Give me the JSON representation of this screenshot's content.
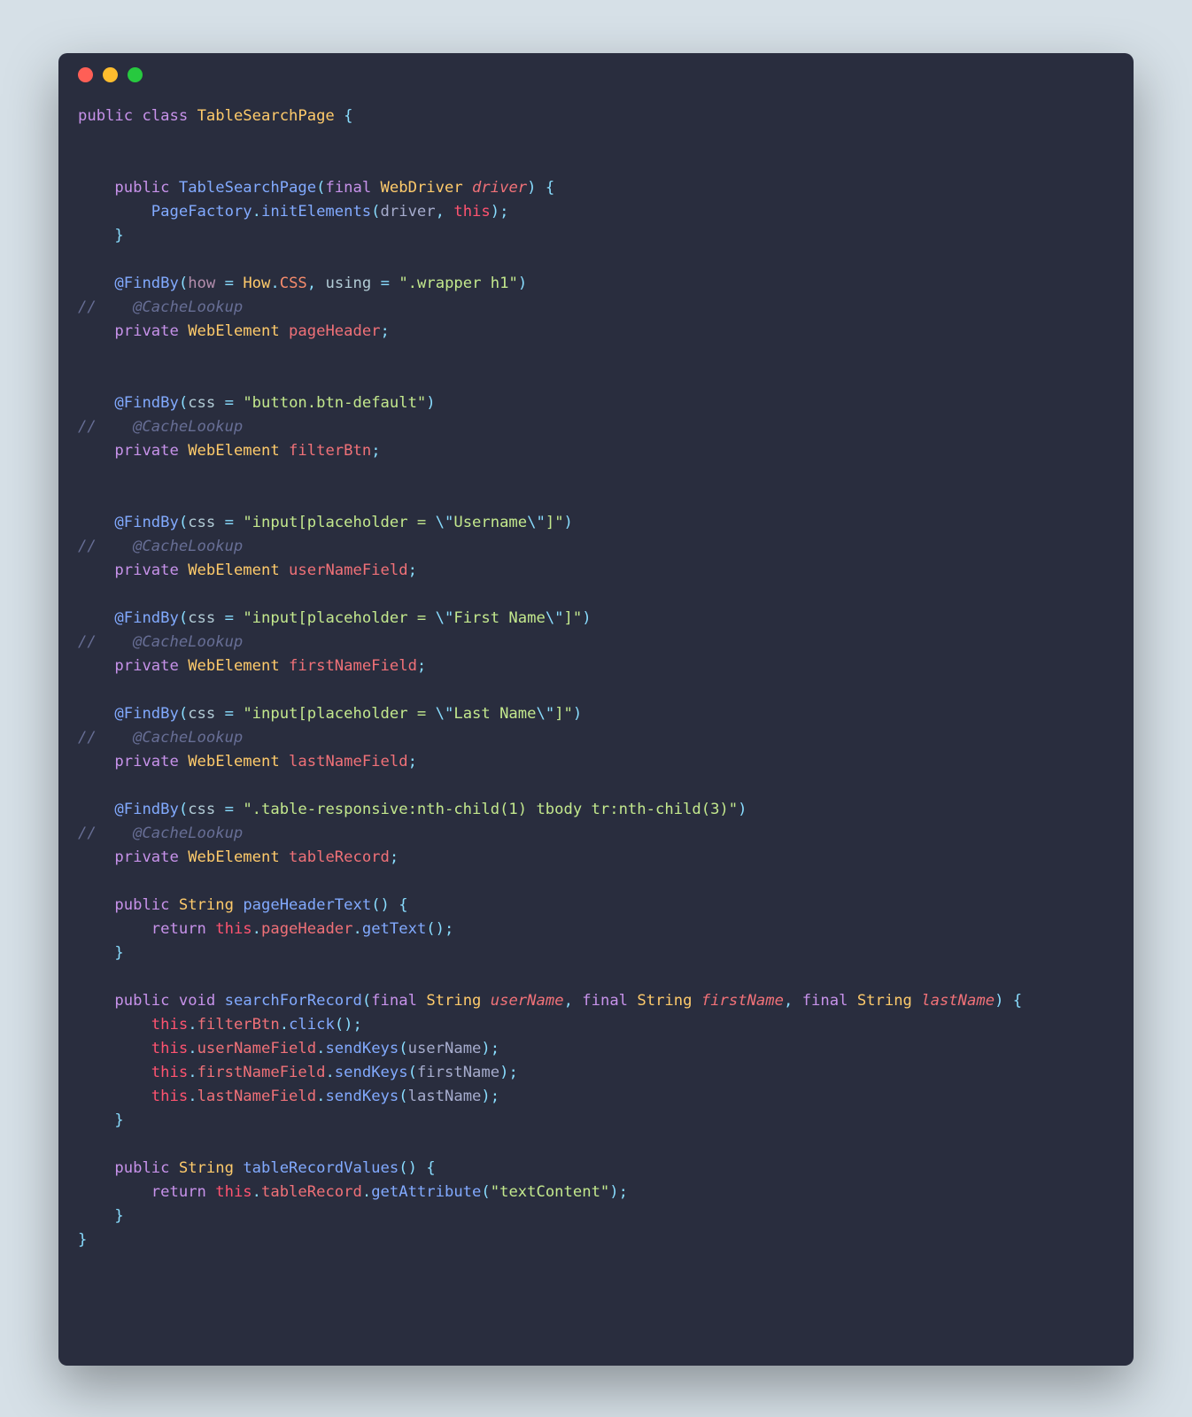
{
  "window": {
    "traffic_lights": [
      "close",
      "minimize",
      "zoom"
    ]
  },
  "code": {
    "language": "java",
    "tokens": [
      [
        [
          "kw",
          "public"
        ],
        [
          "plain",
          " "
        ],
        [
          "kw",
          "class"
        ],
        [
          "plain",
          " "
        ],
        [
          "type",
          "TableSearchPage"
        ],
        [
          "plain",
          " "
        ],
        [
          "op",
          "{"
        ]
      ],
      [],
      [],
      [
        [
          "plain",
          "    "
        ],
        [
          "kw",
          "public"
        ],
        [
          "plain",
          " "
        ],
        [
          "name",
          "TableSearchPage"
        ],
        [
          "op",
          "("
        ],
        [
          "kw",
          "final"
        ],
        [
          "plain",
          " "
        ],
        [
          "type",
          "WebDriver"
        ],
        [
          "plain",
          " "
        ],
        [
          "param",
          "driver"
        ],
        [
          "op",
          ")"
        ],
        [
          "plain",
          " "
        ],
        [
          "op",
          "{"
        ]
      ],
      [
        [
          "plain",
          "        "
        ],
        [
          "name",
          "PageFactory"
        ],
        [
          "op",
          "."
        ],
        [
          "name",
          "initElements"
        ],
        [
          "op",
          "("
        ],
        [
          "plain",
          "driver"
        ],
        [
          "op",
          ","
        ],
        [
          "plain",
          " "
        ],
        [
          "this",
          "this"
        ],
        [
          "op",
          ")"
        ],
        [
          "op",
          ";"
        ]
      ],
      [
        [
          "plain",
          "    "
        ],
        [
          "op",
          "}"
        ]
      ],
      [],
      [
        [
          "plain",
          "    "
        ],
        [
          "ann",
          "@FindBy"
        ],
        [
          "op",
          "("
        ],
        [
          "kwhow",
          "how"
        ],
        [
          "plain",
          " "
        ],
        [
          "op",
          "="
        ],
        [
          "plain",
          " "
        ],
        [
          "type",
          "How"
        ],
        [
          "op",
          "."
        ],
        [
          "const",
          "CSS"
        ],
        [
          "op",
          ","
        ],
        [
          "plain",
          " "
        ],
        [
          "css",
          "using"
        ],
        [
          "plain",
          " "
        ],
        [
          "op",
          "="
        ],
        [
          "plain",
          " "
        ],
        [
          "str",
          "\".wrapper h1\""
        ],
        [
          "op",
          ")"
        ]
      ],
      [
        [
          "cmt",
          "//    @CacheLookup"
        ]
      ],
      [
        [
          "plain",
          "    "
        ],
        [
          "kw",
          "private"
        ],
        [
          "plain",
          " "
        ],
        [
          "type",
          "WebElement"
        ],
        [
          "plain",
          " "
        ],
        [
          "field",
          "pageHeader"
        ],
        [
          "op",
          ";"
        ]
      ],
      [],
      [],
      [
        [
          "plain",
          "    "
        ],
        [
          "ann",
          "@FindBy"
        ],
        [
          "op",
          "("
        ],
        [
          "css",
          "css"
        ],
        [
          "plain",
          " "
        ],
        [
          "op",
          "="
        ],
        [
          "plain",
          " "
        ],
        [
          "str",
          "\"button.btn-default\""
        ],
        [
          "op",
          ")"
        ]
      ],
      [
        [
          "cmt",
          "//    @CacheLookup"
        ]
      ],
      [
        [
          "plain",
          "    "
        ],
        [
          "kw",
          "private"
        ],
        [
          "plain",
          " "
        ],
        [
          "type",
          "WebElement"
        ],
        [
          "plain",
          " "
        ],
        [
          "field",
          "filterBtn"
        ],
        [
          "op",
          ";"
        ]
      ],
      [],
      [],
      [
        [
          "plain",
          "    "
        ],
        [
          "ann",
          "@FindBy"
        ],
        [
          "op",
          "("
        ],
        [
          "css",
          "css"
        ],
        [
          "plain",
          " "
        ],
        [
          "op",
          "="
        ],
        [
          "plain",
          " "
        ],
        [
          "str",
          "\"input[placeholder = "
        ],
        [
          "esc",
          "\\\""
        ],
        [
          "str",
          "Username"
        ],
        [
          "esc",
          "\\\""
        ],
        [
          "str",
          "]\""
        ],
        [
          "op",
          ")"
        ]
      ],
      [
        [
          "cmt",
          "//    @CacheLookup"
        ]
      ],
      [
        [
          "plain",
          "    "
        ],
        [
          "kw",
          "private"
        ],
        [
          "plain",
          " "
        ],
        [
          "type",
          "WebElement"
        ],
        [
          "plain",
          " "
        ],
        [
          "field",
          "userNameField"
        ],
        [
          "op",
          ";"
        ]
      ],
      [],
      [
        [
          "plain",
          "    "
        ],
        [
          "ann",
          "@FindBy"
        ],
        [
          "op",
          "("
        ],
        [
          "css",
          "css"
        ],
        [
          "plain",
          " "
        ],
        [
          "op",
          "="
        ],
        [
          "plain",
          " "
        ],
        [
          "str",
          "\"input[placeholder = "
        ],
        [
          "esc",
          "\\\""
        ],
        [
          "str",
          "First Name"
        ],
        [
          "esc",
          "\\\""
        ],
        [
          "str",
          "]\""
        ],
        [
          "op",
          ")"
        ]
      ],
      [
        [
          "cmt",
          "//    @CacheLookup"
        ]
      ],
      [
        [
          "plain",
          "    "
        ],
        [
          "kw",
          "private"
        ],
        [
          "plain",
          " "
        ],
        [
          "type",
          "WebElement"
        ],
        [
          "plain",
          " "
        ],
        [
          "field",
          "firstNameField"
        ],
        [
          "op",
          ";"
        ]
      ],
      [],
      [
        [
          "plain",
          "    "
        ],
        [
          "ann",
          "@FindBy"
        ],
        [
          "op",
          "("
        ],
        [
          "css",
          "css"
        ],
        [
          "plain",
          " "
        ],
        [
          "op",
          "="
        ],
        [
          "plain",
          " "
        ],
        [
          "str",
          "\"input[placeholder = "
        ],
        [
          "esc",
          "\\\""
        ],
        [
          "str",
          "Last Name"
        ],
        [
          "esc",
          "\\\""
        ],
        [
          "str",
          "]\""
        ],
        [
          "op",
          ")"
        ]
      ],
      [
        [
          "cmt",
          "//    @CacheLookup"
        ]
      ],
      [
        [
          "plain",
          "    "
        ],
        [
          "kw",
          "private"
        ],
        [
          "plain",
          " "
        ],
        [
          "type",
          "WebElement"
        ],
        [
          "plain",
          " "
        ],
        [
          "field",
          "lastNameField"
        ],
        [
          "op",
          ";"
        ]
      ],
      [],
      [
        [
          "plain",
          "    "
        ],
        [
          "ann",
          "@FindBy"
        ],
        [
          "op",
          "("
        ],
        [
          "css",
          "css"
        ],
        [
          "plain",
          " "
        ],
        [
          "op",
          "="
        ],
        [
          "plain",
          " "
        ],
        [
          "str",
          "\".table-responsive:nth-child(1) tbody tr:nth-child(3)\""
        ],
        [
          "op",
          ")"
        ]
      ],
      [
        [
          "cmt",
          "//    @CacheLookup"
        ]
      ],
      [
        [
          "plain",
          "    "
        ],
        [
          "kw",
          "private"
        ],
        [
          "plain",
          " "
        ],
        [
          "type",
          "WebElement"
        ],
        [
          "plain",
          " "
        ],
        [
          "field",
          "tableRecord"
        ],
        [
          "op",
          ";"
        ]
      ],
      [],
      [
        [
          "plain",
          "    "
        ],
        [
          "kw",
          "public"
        ],
        [
          "plain",
          " "
        ],
        [
          "type",
          "String"
        ],
        [
          "plain",
          " "
        ],
        [
          "name",
          "pageHeaderText"
        ],
        [
          "op",
          "()"
        ],
        [
          "plain",
          " "
        ],
        [
          "op",
          "{"
        ]
      ],
      [
        [
          "plain",
          "        "
        ],
        [
          "kw",
          "return"
        ],
        [
          "plain",
          " "
        ],
        [
          "this",
          "this"
        ],
        [
          "op",
          "."
        ],
        [
          "field",
          "pageHeader"
        ],
        [
          "op",
          "."
        ],
        [
          "name",
          "getText"
        ],
        [
          "op",
          "()"
        ],
        [
          "op",
          ";"
        ]
      ],
      [
        [
          "plain",
          "    "
        ],
        [
          "op",
          "}"
        ]
      ],
      [],
      [
        [
          "plain",
          "    "
        ],
        [
          "kw",
          "public"
        ],
        [
          "plain",
          " "
        ],
        [
          "kw",
          "void"
        ],
        [
          "plain",
          " "
        ],
        [
          "name",
          "searchForRecord"
        ],
        [
          "op",
          "("
        ],
        [
          "kw",
          "final"
        ],
        [
          "plain",
          " "
        ],
        [
          "type",
          "String"
        ],
        [
          "plain",
          " "
        ],
        [
          "param",
          "userName"
        ],
        [
          "op",
          ","
        ],
        [
          "plain",
          " "
        ],
        [
          "kw",
          "final"
        ],
        [
          "plain",
          " "
        ],
        [
          "type",
          "String"
        ],
        [
          "plain",
          " "
        ],
        [
          "param",
          "firstName"
        ],
        [
          "op",
          ","
        ],
        [
          "plain",
          " "
        ],
        [
          "kw",
          "final"
        ],
        [
          "plain",
          " "
        ],
        [
          "type",
          "String"
        ],
        [
          "plain",
          " "
        ],
        [
          "param",
          "lastName"
        ],
        [
          "op",
          ")"
        ],
        [
          "plain",
          " "
        ],
        [
          "op",
          "{"
        ]
      ],
      [
        [
          "plain",
          "        "
        ],
        [
          "this",
          "this"
        ],
        [
          "op",
          "."
        ],
        [
          "field",
          "filterBtn"
        ],
        [
          "op",
          "."
        ],
        [
          "name",
          "click"
        ],
        [
          "op",
          "()"
        ],
        [
          "op",
          ";"
        ]
      ],
      [
        [
          "plain",
          "        "
        ],
        [
          "this",
          "this"
        ],
        [
          "op",
          "."
        ],
        [
          "field",
          "userNameField"
        ],
        [
          "op",
          "."
        ],
        [
          "name",
          "sendKeys"
        ],
        [
          "op",
          "("
        ],
        [
          "plain",
          "userName"
        ],
        [
          "op",
          ")"
        ],
        [
          "op",
          ";"
        ]
      ],
      [
        [
          "plain",
          "        "
        ],
        [
          "this",
          "this"
        ],
        [
          "op",
          "."
        ],
        [
          "field",
          "firstNameField"
        ],
        [
          "op",
          "."
        ],
        [
          "name",
          "sendKeys"
        ],
        [
          "op",
          "("
        ],
        [
          "plain",
          "firstName"
        ],
        [
          "op",
          ")"
        ],
        [
          "op",
          ";"
        ]
      ],
      [
        [
          "plain",
          "        "
        ],
        [
          "this",
          "this"
        ],
        [
          "op",
          "."
        ],
        [
          "field",
          "lastNameField"
        ],
        [
          "op",
          "."
        ],
        [
          "name",
          "sendKeys"
        ],
        [
          "op",
          "("
        ],
        [
          "plain",
          "lastName"
        ],
        [
          "op",
          ")"
        ],
        [
          "op",
          ";"
        ]
      ],
      [
        [
          "plain",
          "    "
        ],
        [
          "op",
          "}"
        ]
      ],
      [],
      [
        [
          "plain",
          "    "
        ],
        [
          "kw",
          "public"
        ],
        [
          "plain",
          " "
        ],
        [
          "type",
          "String"
        ],
        [
          "plain",
          " "
        ],
        [
          "name",
          "tableRecordValues"
        ],
        [
          "op",
          "()"
        ],
        [
          "plain",
          " "
        ],
        [
          "op",
          "{"
        ]
      ],
      [
        [
          "plain",
          "        "
        ],
        [
          "kw",
          "return"
        ],
        [
          "plain",
          " "
        ],
        [
          "this",
          "this"
        ],
        [
          "op",
          "."
        ],
        [
          "field",
          "tableRecord"
        ],
        [
          "op",
          "."
        ],
        [
          "name",
          "getAttribute"
        ],
        [
          "op",
          "("
        ],
        [
          "str",
          "\"textContent\""
        ],
        [
          "op",
          ")"
        ],
        [
          "op",
          ";"
        ]
      ],
      [
        [
          "plain",
          "    "
        ],
        [
          "op",
          "}"
        ]
      ],
      [
        [
          "op",
          "}"
        ]
      ]
    ]
  }
}
